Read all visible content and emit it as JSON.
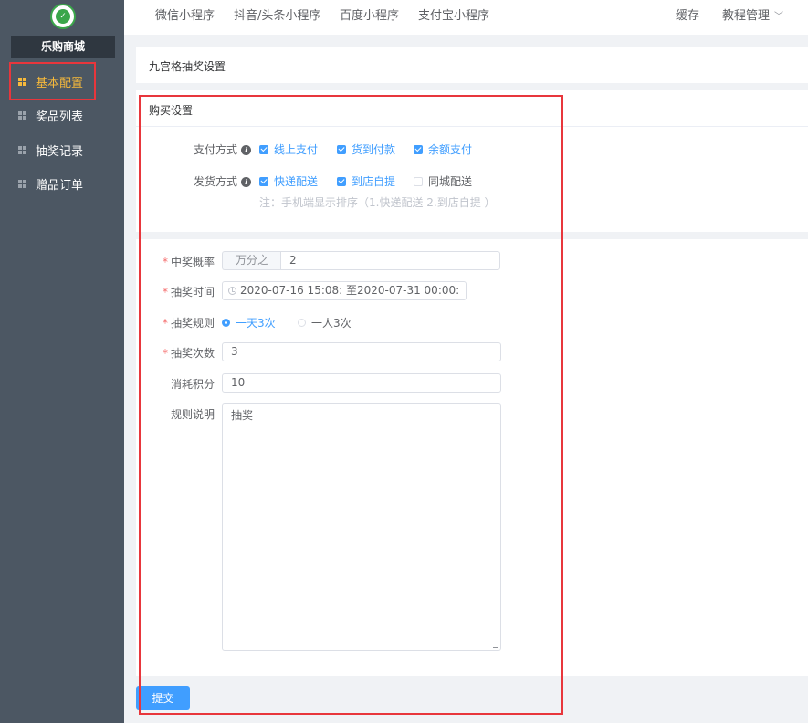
{
  "sidebar": {
    "store_name": "乐购商城",
    "items": [
      {
        "label": "基本配置",
        "active": true
      },
      {
        "label": "奖品列表",
        "active": false
      },
      {
        "label": "抽奖记录",
        "active": false
      },
      {
        "label": "赠品订单",
        "active": false
      }
    ]
  },
  "topbar": {
    "tabs": [
      "微信小程序",
      "抖音/头条小程序",
      "百度小程序",
      "支付宝小程序"
    ],
    "cache": "缓存",
    "tutorial": "教程管理"
  },
  "page_title": "九宫格抽奖设置",
  "buy_settings": {
    "title": "购买设置",
    "payment_label": "支付方式",
    "payment_options": [
      {
        "label": "线上支付",
        "checked": true
      },
      {
        "label": "货到付款",
        "checked": true
      },
      {
        "label": "余额支付",
        "checked": true
      }
    ],
    "delivery_label": "发货方式",
    "delivery_options": [
      {
        "label": "快递配送",
        "checked": true
      },
      {
        "label": "到店自提",
        "checked": true
      },
      {
        "label": "同城配送",
        "checked": false
      }
    ],
    "note": "注：手机端显示排序（1.快递配送 2.到店自提 ）"
  },
  "form": {
    "probability_label": "中奖概率",
    "probability_prepend": "万分之",
    "probability_value": "2",
    "time_label": "抽奖时间",
    "time_value": "2020-07-16 15:08: 至2020-07-31 00:00:",
    "rule_label": "抽奖规则",
    "rule_options": [
      {
        "label": "一天3次",
        "selected": true
      },
      {
        "label": "一人3次",
        "selected": false
      }
    ],
    "count_label": "抽奖次数",
    "count_value": "3",
    "points_label": "消耗积分",
    "points_value": "10",
    "desc_label": "规则说明",
    "desc_value": "抽奖"
  },
  "submit_label": "提交",
  "colors": {
    "primary": "#409eff",
    "sidebar": "#4c5763",
    "active": "#f6b93b",
    "highlight": "#e8363c"
  }
}
